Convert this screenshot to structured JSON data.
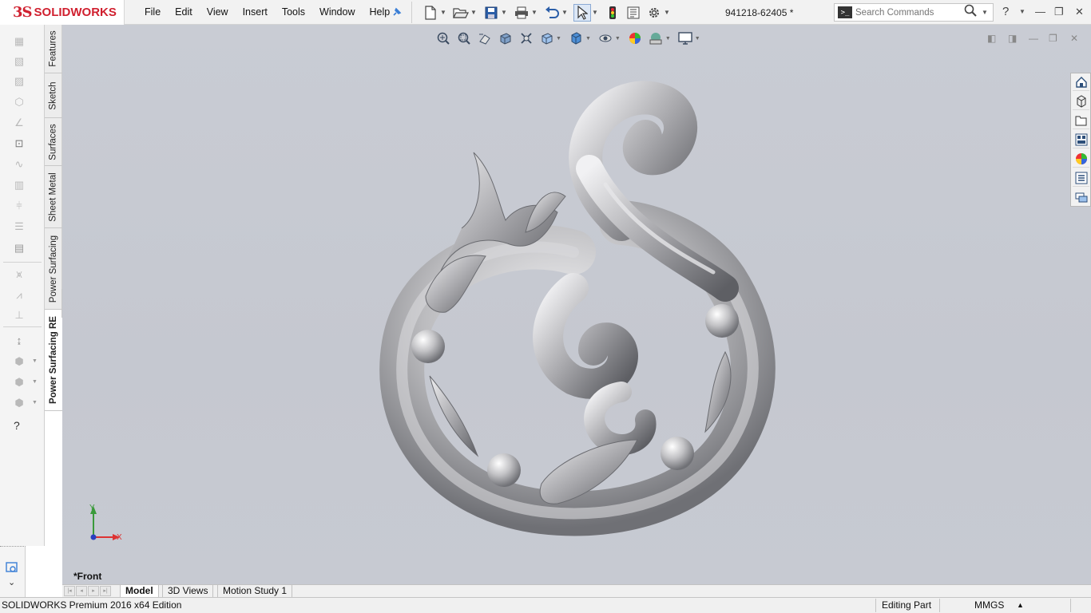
{
  "app": {
    "brand_ds": "3S",
    "brand_name": "SOLIDWORKS",
    "document_title": "941218-62405 *"
  },
  "menu": [
    "File",
    "Edit",
    "View",
    "Insert",
    "Tools",
    "Window",
    "Help"
  ],
  "search": {
    "placeholder": "Search Commands"
  },
  "help_label": "?",
  "vertical_tabs": [
    {
      "label": "Features"
    },
    {
      "label": "Sketch"
    },
    {
      "label": "Surfaces"
    },
    {
      "label": "Sheet Metal"
    },
    {
      "label": "Power Surfacing"
    },
    {
      "label": "Power Surfacing RE",
      "active": true
    }
  ],
  "viewport": {
    "view_name": "*Front",
    "triad": {
      "x_label": "X",
      "y_label": "Y"
    },
    "background_color": "#c6c9d1",
    "model_color": "#b7b7b9"
  },
  "model_tabs": [
    {
      "label": "Model",
      "active": true
    },
    {
      "label": "3D Views"
    },
    {
      "label": "Motion Study 1"
    }
  ],
  "status": {
    "product": "SOLIDWORKS Premium 2016 x64 Edition",
    "mode": "Editing Part",
    "units": "MMGS",
    "units_arrow": "▲"
  },
  "colors": {
    "brand_red": "#d0202f",
    "accent_blue": "#3b7fd6"
  }
}
